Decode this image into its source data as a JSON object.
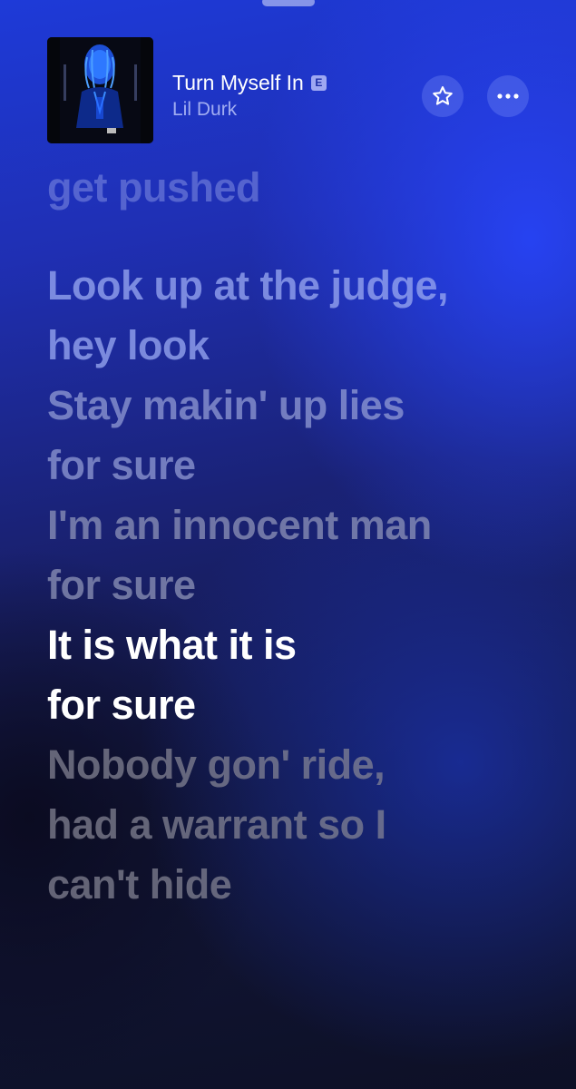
{
  "now_playing": {
    "title": "Turn Myself In",
    "explicit_badge": "E",
    "artist": "Lil Durk"
  },
  "buttons": {
    "favorite_icon": "star-icon",
    "more_icon": "ellipsis-icon"
  },
  "lyrics": {
    "previous_partial": "get pushed",
    "lines": [
      {
        "line1": "Look up at the judge,",
        "line2": "hey look"
      },
      {
        "line1": "Stay makin' up lies",
        "line2": "for sure"
      },
      {
        "line1": "I'm an innocent man",
        "line2": "for sure"
      },
      {
        "line1": "It is what it is",
        "line2": "for sure"
      },
      {
        "line1": "Nobody gon' ride,",
        "line2": "had a warrant so I",
        "line3": "can't hide"
      }
    ]
  },
  "colors": {
    "accent": "#1e3ad8",
    "current_lyric": "#ffffff"
  }
}
